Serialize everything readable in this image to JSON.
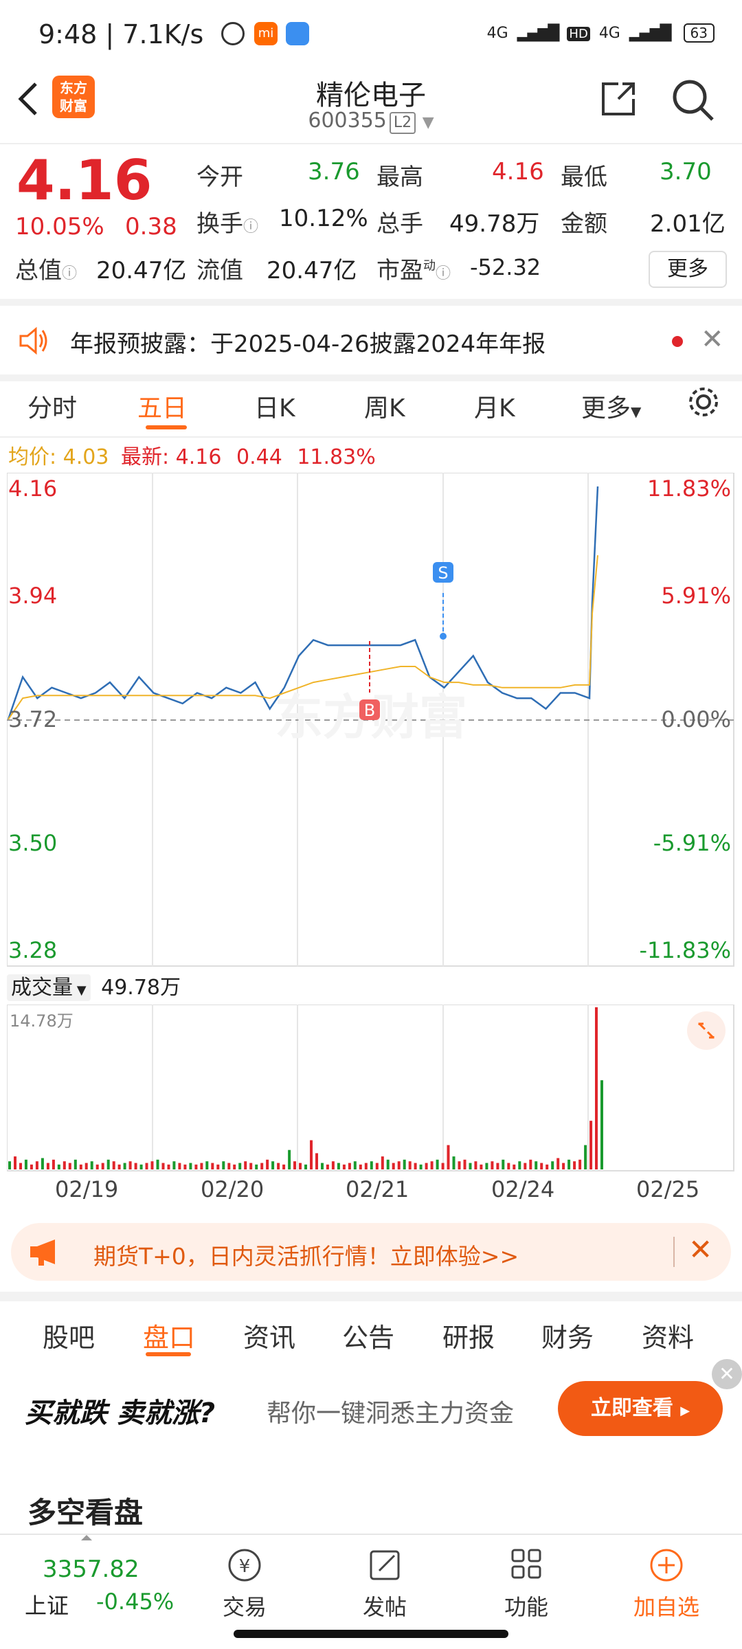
{
  "status_bar": {
    "time_speed": "9:48 | 7.1K/s",
    "network_1": "4G",
    "hd": "HD",
    "network_2": "4G",
    "battery": "63"
  },
  "header": {
    "logo_line1": "东方",
    "logo_line2": "财富",
    "stock_name": "精伦电子",
    "stock_code": "600355",
    "level": "L2"
  },
  "quote": {
    "price": "4.16",
    "change_pct": "10.05%",
    "change_amt": "0.38",
    "open_label": "今开",
    "open": "3.76",
    "high_label": "最高",
    "high": "4.16",
    "low_label": "最低",
    "low": "3.70",
    "turnover_label": "换手",
    "turnover": "10.12%",
    "volume_label": "总手",
    "volume": "49.78万",
    "amount_label": "金额",
    "amount": "2.01亿",
    "mktcap_label": "总值",
    "mktcap": "20.47亿",
    "float_label": "流值",
    "float": "20.47亿",
    "pe_label": "市盈",
    "pe_sup": "动",
    "pe": "-52.32",
    "more": "更多"
  },
  "notice": {
    "text": "年报预披露：于2025-04-26披露2024年年报"
  },
  "chart_tabs": [
    "分时",
    "五日",
    "日K",
    "周K",
    "月K",
    "更多"
  ],
  "chart_tab_active": 1,
  "legend": {
    "avg_label": "均价: 4.03",
    "latest_label": "最新: 4.16",
    "latest_change": "0.44",
    "latest_pct": "11.83%"
  },
  "chart_data": {
    "type": "line",
    "y_left_ticks": [
      "4.16",
      "3.94",
      "3.72",
      "3.50",
      "3.28"
    ],
    "y_right_ticks": [
      "11.83%",
      "5.91%",
      "0.00%",
      "-5.91%",
      "-11.83%"
    ],
    "ylim": [
      3.28,
      4.16
    ],
    "x_ticks": [
      "02/19",
      "02/20",
      "02/21",
      "02/24",
      "02/25"
    ],
    "series": [
      {
        "values": [
          3.72,
          3.8,
          3.76,
          3.78,
          3.77,
          3.76,
          3.77,
          3.79,
          3.76,
          3.8,
          3.77,
          3.76,
          3.75,
          3.77,
          3.76,
          3.78,
          3.77,
          3.79,
          3.74,
          3.78,
          3.84,
          3.87,
          3.86,
          3.86,
          3.86,
          3.86,
          3.86,
          3.86,
          3.87,
          3.8,
          3.78,
          3.81,
          3.84,
          3.79,
          3.77,
          3.76,
          3.76,
          3.74,
          3.77,
          3.77,
          3.76,
          3.94,
          4.16
        ]
      },
      {
        "values": [
          3.72,
          3.76,
          3.765,
          3.765,
          3.765,
          3.765,
          3.765,
          3.765,
          3.765,
          3.765,
          3.765,
          3.765,
          3.765,
          3.765,
          3.765,
          3.765,
          3.765,
          3.765,
          3.76,
          3.77,
          3.78,
          3.79,
          3.795,
          3.8,
          3.805,
          3.81,
          3.815,
          3.82,
          3.82,
          3.8,
          3.79,
          3.79,
          3.785,
          3.785,
          3.78,
          3.78,
          3.78,
          3.78,
          3.78,
          3.785,
          3.785,
          3.92,
          4.03
        ]
      }
    ],
    "markers": [
      "S",
      "B"
    ]
  },
  "volume": {
    "label": "成交量",
    "total": "49.78万",
    "max": "14.78万",
    "bars": [
      0.05,
      0.08,
      0.04,
      0.06,
      0.03,
      0.05,
      0.07,
      0.04,
      0.06,
      0.03,
      0.05,
      0.04,
      0.06,
      0.03,
      0.04,
      0.05,
      0.03,
      0.04,
      0.06,
      0.05,
      0.03,
      0.04,
      0.05,
      0.04,
      0.03,
      0.04,
      0.05,
      0.06,
      0.04,
      0.03,
      0.05,
      0.04,
      0.03,
      0.04,
      0.03,
      0.04,
      0.05,
      0.04,
      0.03,
      0.05,
      0.04,
      0.03,
      0.04,
      0.05,
      0.04,
      0.03,
      0.04,
      0.06,
      0.05,
      0.04,
      0.03,
      0.12,
      0.05,
      0.04,
      0.03,
      0.18,
      0.1,
      0.04,
      0.03,
      0.05,
      0.04,
      0.03,
      0.04,
      0.05,
      0.03,
      0.04,
      0.05,
      0.04,
      0.08,
      0.06,
      0.04,
      0.05,
      0.06,
      0.05,
      0.04,
      0.03,
      0.04,
      0.05,
      0.06,
      0.04,
      0.15,
      0.08,
      0.05,
      0.06,
      0.04,
      0.05,
      0.03,
      0.04,
      0.05,
      0.04,
      0.06,
      0.04,
      0.03,
      0.05,
      0.04,
      0.06,
      0.05,
      0.04,
      0.03,
      0.05,
      0.07,
      0.04,
      0.06,
      0.05,
      0.06,
      0.15,
      0.3,
      1.0,
      0.55
    ]
  },
  "banner": {
    "text": "期货T+0，日内灵活抓行情！立即体验>>"
  },
  "bottom_tabs": [
    "股吧",
    "盘口",
    "资讯",
    "公告",
    "研报",
    "财务",
    "资料"
  ],
  "bottom_tab_active": 1,
  "ad": {
    "slogan": "买就跌 卖就涨?",
    "desc": "帮你一键洞悉主力资金",
    "button": "立即查看"
  },
  "section_title": "多空看盘",
  "nav": {
    "index_value": "3357.82",
    "index_name": "上证",
    "index_change": "-0.45%",
    "items": [
      "交易",
      "发帖",
      "功能",
      "加自选"
    ]
  },
  "colors": {
    "accent": "#ff6a1a",
    "up": "#e0252b",
    "down": "#1a9a2e",
    "line": "#2f6eb5",
    "avg": "#f0b429"
  }
}
